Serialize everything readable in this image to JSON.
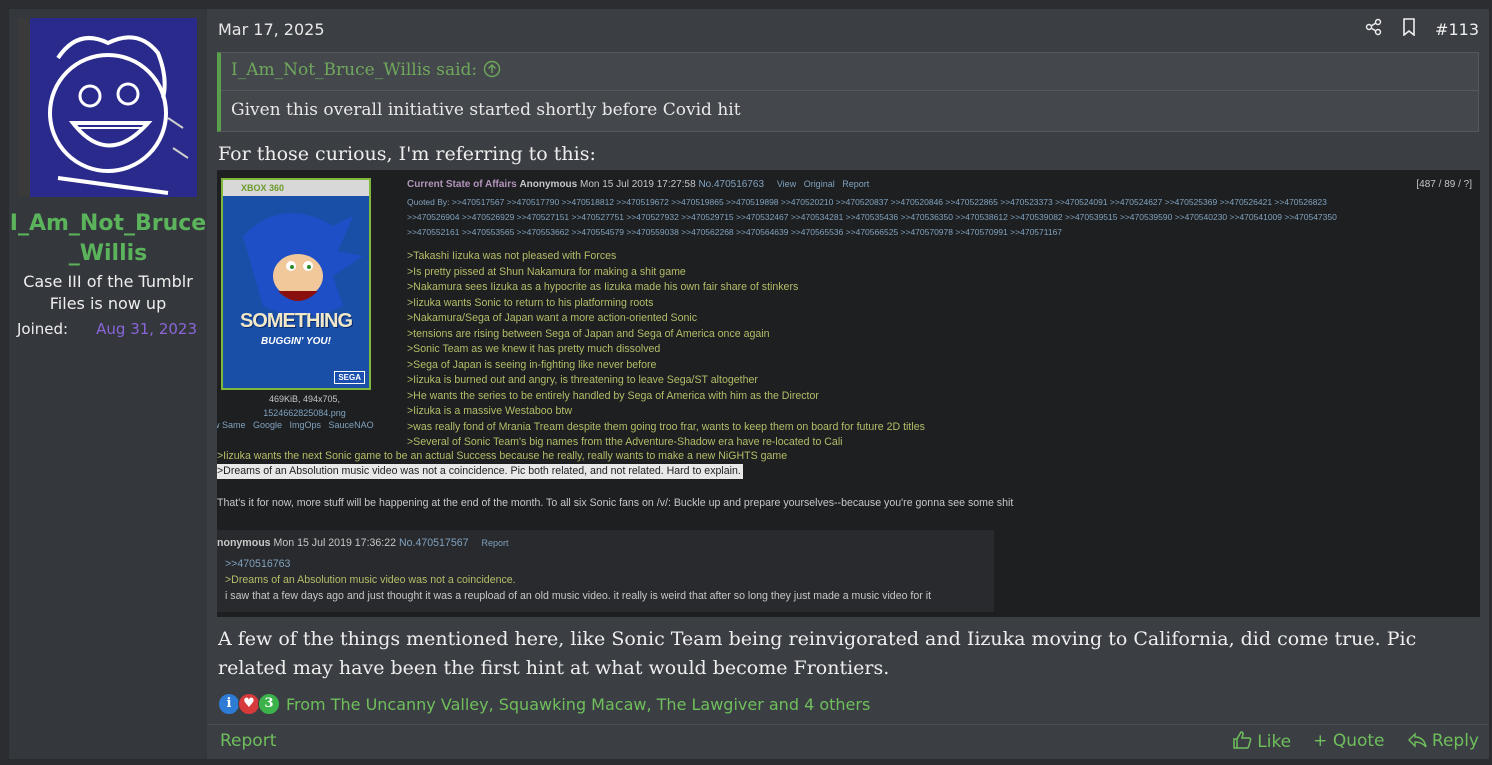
{
  "author": {
    "username": "I_Am_Not_Bruce_Willis",
    "username_line1": "I_Am_Not_Bruce",
    "username_line2": "_Willis",
    "title": "Case III of the Tumblr Files is now up",
    "joined_label": "Joined:",
    "joined_date": "Aug 31, 2023"
  },
  "post": {
    "date": "Mar 17, 2025",
    "number": "#113",
    "quote_source": "I_Am_Not_Bruce_Willis said:",
    "quote_body": "Given this overall initiative started shortly before Covid hit",
    "intro": "For those curious, I'm referring to this:",
    "outro": "A few of the things mentioned here, like Sonic Team being reinvigorated and Iizuka moving to California, did come true. Pic related may have been the first hint at what would become Frontiers."
  },
  "screenshot": {
    "thumb_brand": "XBOX 360",
    "thumb_title": "SOMETHING",
    "thumb_subtitle": "BUGGIN' YOU!",
    "thumb_publisher": "SEGA",
    "file_size": "469KiB, 494x705,",
    "file_name": "1524662825084.png",
    "image_links": "w Same   Google   ImgOps   SauceNAO",
    "subject": "Current State of Affairs",
    "name": "Anonymous",
    "datetime": "Mon 15 Jul 2019 17:27:58",
    "post_no": "No.470516763",
    "links": "View   Original   Report",
    "stats": "[487 / 89 / ?]",
    "quoted_by_1": "Quoted By: >>470517567 >>470517790 >>470518812 >>470519672 >>470519865 >>470519898 >>470520210 >>470520837 >>470520846 >>470522865 >>470523373 >>470524091 >>470524627 >>470525369 >>470526421 >>470526823",
    "quoted_by_2": ">>470526904 >>470526929 >>470527151 >>470527751 >>470527932 >>470529715 >>470532467 >>470534281 >>470535436 >>470536350 >>470538612 >>470539082 >>470539515 >>470539590 >>470540230 >>470541009 >>470547350",
    "quoted_by_3": ">>470552161 >>470553565 >>470553662 >>470554579 >>470559038 >>470562268 >>470564639 >>470565536 >>470566525 >>470570978 >>470570991 >>470571167",
    "greentext": [
      ">Takashi Iizuka was not pleased with Forces",
      ">Is pretty pissed at Shun Nakamura for making a shit game",
      ">Nakamura sees Iizuka as a hypocrite as Iizuka made his own fair share of stinkers",
      ">Iizuka wants Sonic to return to his platforming roots",
      ">Nakamura/Sega of Japan want a more action-oriented Sonic",
      ">tensions are rising between Sega of Japan and Sega of America once again",
      ">Sonic Team as we knew it has pretty much dissolved",
      ">Sega of Japan is seeing in-fighting like never before",
      ">Iizuka is burned out and angry, is threatening to leave Sega/ST altogether",
      ">He wants the series to be entirely handled by Sega of America with him as the Director",
      ">Iizuka is a massive Westaboo btw",
      ">was really fond of Mrania Tream despite them going troo frar, wants to keep them on board for future 2D titles",
      ">Several of Sonic Team's big names from tthe Adventure-Shadow era have re-located to Cali"
    ],
    "greentext_wide": ">Iizuka wants the next Sonic game to be an actual Success because he really, really wants to make a new NiGHTS game",
    "greentext_highlight": ">Dreams of an Absolution music video was not a coincidence. Pic both related, and not related. Hard to explain.",
    "closing": "That's it for now, more stuff will be happening at the end of the month. To all six Sonic fans on /v/: Buckle up and prepare yourselves--because you're gonna see some shit",
    "reply_name": "nonymous",
    "reply_datetime": "Mon 15 Jul 2019 17:36:22",
    "reply_no": "No.470517567",
    "reply_report": "Report",
    "reply_link": ">>470516763",
    "reply_gt": ">Dreams of an Absolution music video was not a coincidence.",
    "reply_text": "i saw that a few days ago and just thought it was a reupload of an old music video. it really is weird that after so long they just made a music video for it"
  },
  "reactions": {
    "text": "From The Uncanny Valley, Squawking Macaw, The Lawgiver and 4 others",
    "icons": [
      "info-icon",
      "heart-icon",
      "laugh-icon"
    ]
  },
  "footer": {
    "report": "Report",
    "like": "Like",
    "quote": "Quote",
    "reply": "Reply"
  }
}
